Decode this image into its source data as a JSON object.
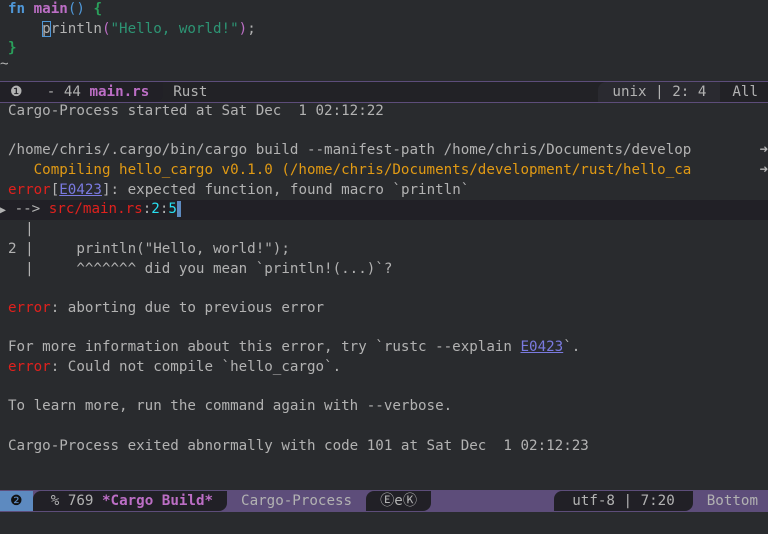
{
  "editor": {
    "lines": [
      {
        "kw": "fn",
        "fn": "main",
        "rest": "() ",
        "brace": "{"
      },
      {
        "indent": "    ",
        "cursor_char": "p",
        "code": "rintln",
        "paren_open": "(",
        "string": "\"Hello, world!\"",
        "paren_close": ")",
        "semi": ";"
      },
      {
        "brace": "}"
      },
      {
        "tilde": "~"
      }
    ]
  },
  "top_modeline": {
    "window_number": "❶",
    "modified": "- 44",
    "buffer": "main.rs",
    "mode": "Rust",
    "encoding": "unix | 2: 4",
    "position": "All"
  },
  "compilation": {
    "started": "Cargo-Process started at Sat Dec  1 02:12:22",
    "command": "/home/chris/.cargo/bin/cargo build --manifest-path /home/chris/Documents/develop",
    "compiling": "   Compiling hello_cargo v0.1.0 (/home/chris/Documents/development/rust/hello_ca",
    "truncation_mark": "➜",
    "error1_label": "error",
    "error1_code": "E0423",
    "error1_msg": ": expected function, found macro `println`",
    "arrow": " --> ",
    "loc_file": "src/main.rs",
    "loc_line": "2",
    "loc_col": "5",
    "pipe1": "  |",
    "code_line": "2 |     println(\"Hello, world!\");",
    "hint_line": "  |     ^^^^^^^ did you mean `println!(...)`?",
    "error2_label": "error",
    "error2_msg": ": aborting due to previous error",
    "info_prefix": "For more information about this error, try `rustc --explain ",
    "info_code": "E0423",
    "info_suffix": "`.",
    "error3_label": "error",
    "error3_msg": ": Could not compile `hello_cargo`.",
    "verbose": "To learn more, run the command again with --verbose.",
    "exited": "Cargo-Process exited abnormally with code 101 at Sat Dec  1 02:12:23"
  },
  "bottom_modeline": {
    "window_number": "❷",
    "modified": "% 769",
    "buffer": "*Cargo Build*",
    "mode": "Cargo-Process",
    "minor": "ⒺeⓀ",
    "encoding": "utf-8 | 7:20",
    "position": "Bottom"
  },
  "colors": {
    "accent": "#5d4d7a",
    "error": "#e0211d",
    "warning": "#e19a14",
    "link": "#7a7ae0",
    "keyword": "#4f97d7",
    "function": "#bc6ec5",
    "string": "#2d9574"
  }
}
